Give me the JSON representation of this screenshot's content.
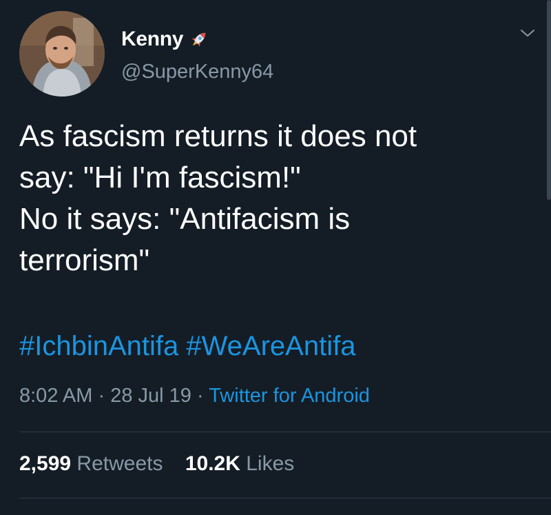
{
  "user": {
    "display_name": "Kenny",
    "handle": "@SuperKenny64"
  },
  "tweet": {
    "text": "As fascism returns it does not\nsay: \"Hi I'm fascism!\"\nNo it says: \"Antifacism is\nterrorism\"",
    "hashtags": [
      "#IchbinAntifa",
      "#WeAreAntifa"
    ]
  },
  "meta": {
    "time": "8:02 AM",
    "date": "28 Jul 19",
    "source": "Twitter for Android",
    "separator": "·"
  },
  "stats": {
    "retweets_count": "2,599",
    "retweets_label": "Retweets",
    "likes_count": "10.2K",
    "likes_label": "Likes"
  },
  "icons": {
    "name_badge": "rocket-icon",
    "menu": "chevron-down-icon"
  },
  "colors": {
    "background": "#141d26",
    "link": "#1b95e0",
    "secondary_text": "#8899a6",
    "primary_text": "#ffffff"
  }
}
